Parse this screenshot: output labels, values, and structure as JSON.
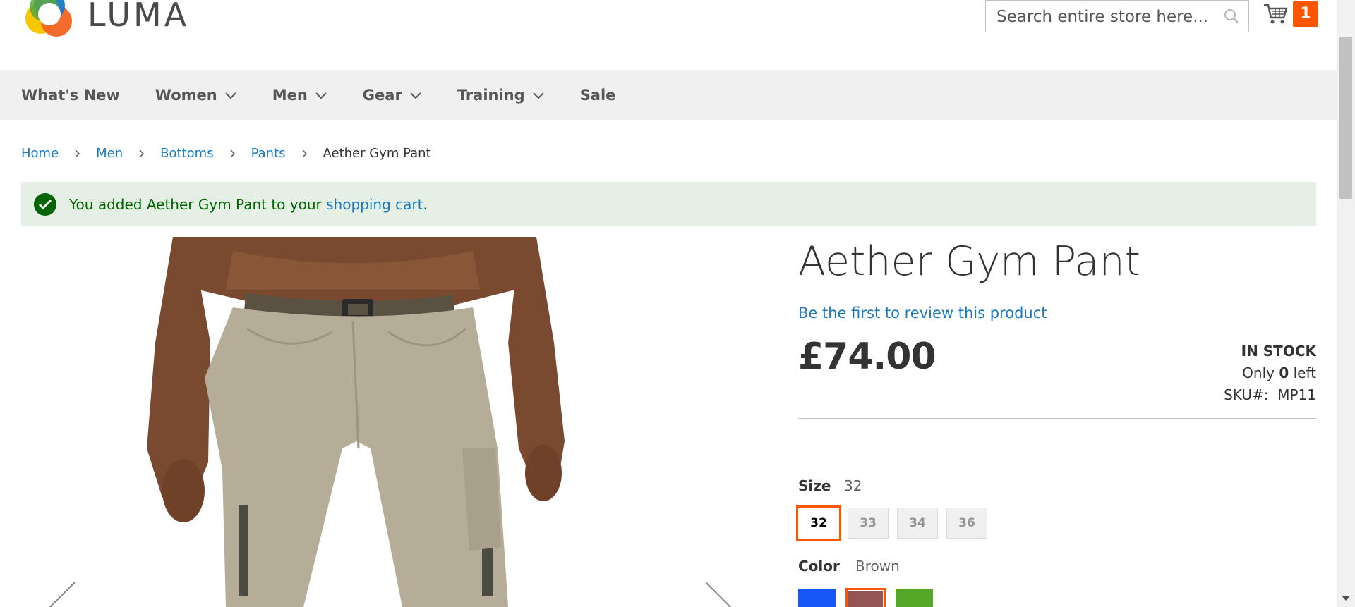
{
  "header": {
    "logo_text": "LUMA",
    "search_placeholder": "Search entire store here...",
    "cart_count": "1"
  },
  "nav": {
    "items": [
      {
        "label": "What's New",
        "has_submenu": false
      },
      {
        "label": "Women",
        "has_submenu": true
      },
      {
        "label": "Men",
        "has_submenu": true
      },
      {
        "label": "Gear",
        "has_submenu": true
      },
      {
        "label": "Training",
        "has_submenu": true
      },
      {
        "label": "Sale",
        "has_submenu": false
      }
    ]
  },
  "breadcrumbs": {
    "home": "Home",
    "men": "Men",
    "bottoms": "Bottoms",
    "pants": "Pants",
    "current": "Aether Gym Pant"
  },
  "message": {
    "prefix": "You added Aether Gym Pant to your ",
    "link": "shopping cart",
    "suffix": "."
  },
  "product": {
    "title": "Aether Gym Pant",
    "review_link": "Be the first to review this product",
    "price": "£74.00",
    "stock_status": "IN STOCK",
    "only_prefix": "Only ",
    "only_count": "0",
    "only_suffix": " left",
    "sku_label": "SKU#:",
    "sku": "MP11"
  },
  "options": {
    "size": {
      "label": "Size",
      "selected": "32",
      "values": [
        "32",
        "33",
        "34",
        "36"
      ]
    },
    "color": {
      "label": "Color",
      "selected": "Brown",
      "swatches": [
        {
          "name": "Blue",
          "hex": "#1857f7"
        },
        {
          "name": "Brown",
          "hex": "#945454"
        },
        {
          "name": "Green",
          "hex": "#53a828"
        }
      ]
    }
  },
  "colors": {
    "accent": "#ff5501",
    "link": "#1979c3",
    "success_bg": "#e5efe5",
    "success_text": "#006400",
    "nav_bg": "#f0f0f0"
  }
}
